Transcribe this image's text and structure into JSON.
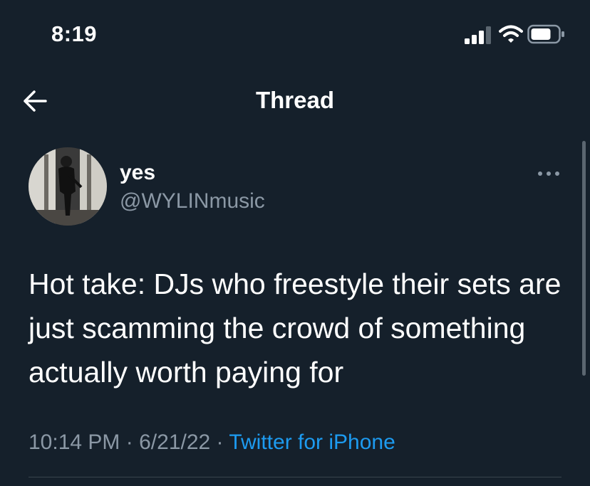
{
  "status_bar": {
    "time": "8:19",
    "signal_icon": "cellular-signal-icon",
    "wifi_icon": "wifi-icon",
    "battery_icon": "battery-icon"
  },
  "nav": {
    "back_icon": "back-arrow-icon",
    "title": "Thread"
  },
  "tweet": {
    "display_name": "yes",
    "handle": "@WYLINmusic",
    "more_icon": "more-options-icon",
    "text": "Hot take: DJs who freestyle their sets are just scamming the crowd of something actually worth paying for",
    "time": "10:14 PM",
    "separator": "·",
    "date": "6/21/22",
    "source": "Twitter for iPhone"
  },
  "colors": {
    "background": "#15202b",
    "secondary_text": "#8b98a5",
    "accent": "#1d9bf0",
    "divider": "#38444d"
  }
}
